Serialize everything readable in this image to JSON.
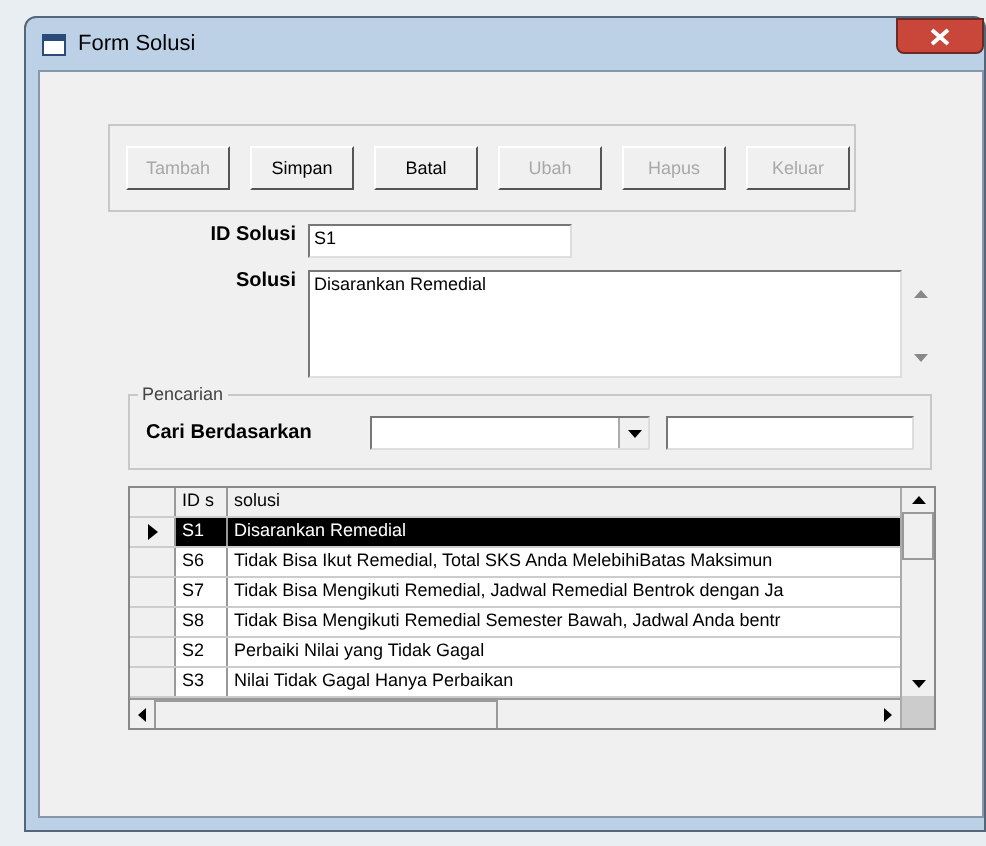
{
  "window": {
    "title": "Form Solusi"
  },
  "buttons": [
    {
      "label": "Tambah",
      "disabled": true
    },
    {
      "label": "Simpan",
      "disabled": false
    },
    {
      "label": "Batal",
      "disabled": false
    },
    {
      "label": "Ubah",
      "disabled": true
    },
    {
      "label": "Hapus",
      "disabled": true
    },
    {
      "label": "Keluar",
      "disabled": true
    }
  ],
  "id_field": {
    "label": "ID Solusi",
    "value": "S1"
  },
  "solusi_field": {
    "label": "Solusi",
    "value": "Disarankan Remedial"
  },
  "search": {
    "group_title": "Pencarian",
    "label": "Cari Berdasarkan"
  },
  "table": {
    "columns": [
      "ID s",
      "solusi"
    ],
    "rows": [
      {
        "cells": [
          "S1",
          "Disarankan Remedial"
        ],
        "selected": true
      },
      {
        "cells": [
          "S6",
          "Tidak Bisa Ikut Remedial, Total SKS Anda MelebihiBatas Maksimun"
        ],
        "selected": false
      },
      {
        "cells": [
          "S7",
          "Tidak Bisa Mengikuti Remedial, Jadwal Remedial Bentrok dengan Ja"
        ],
        "selected": false
      },
      {
        "cells": [
          "S8",
          "Tidak Bisa Mengikuti Remedial Semester Bawah, Jadwal Anda bentr"
        ],
        "selected": false
      },
      {
        "cells": [
          "S2",
          "Perbaiki Nilai yang Tidak Gagal"
        ],
        "selected": false
      },
      {
        "cells": [
          "S3",
          "Nilai Tidak Gagal Hanya Perbaikan"
        ],
        "selected": false
      }
    ]
  }
}
